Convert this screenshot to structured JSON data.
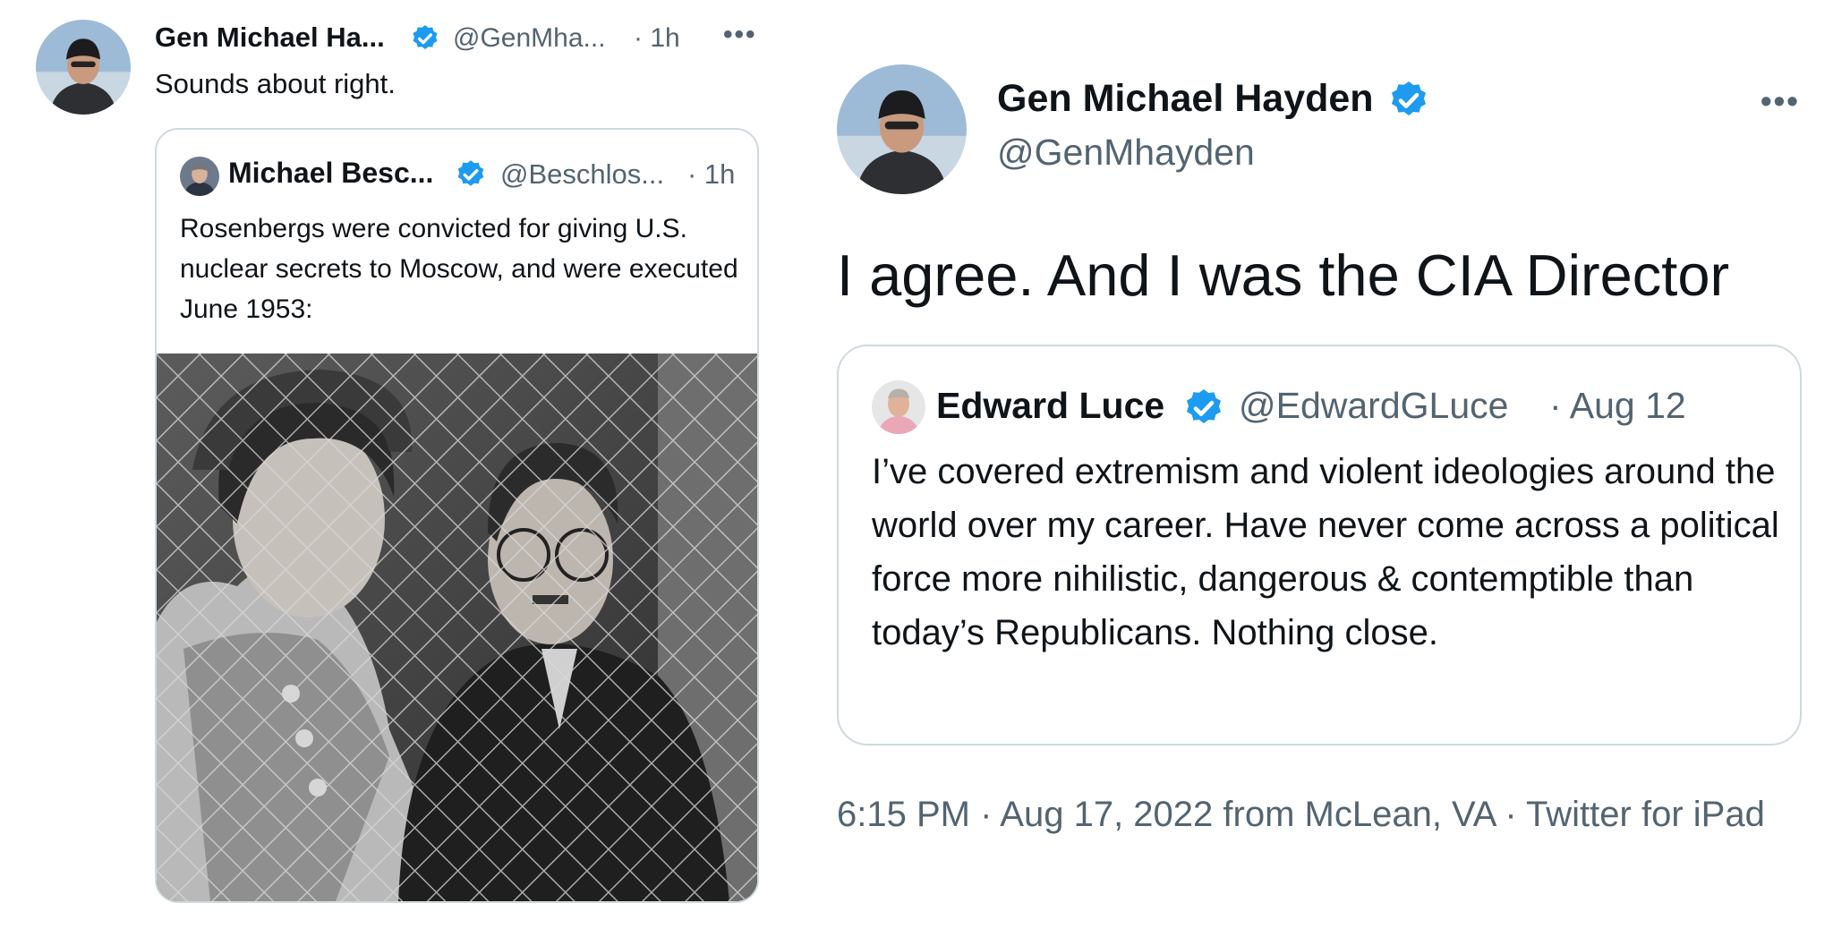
{
  "left_tweet": {
    "author_name": "Gen Michael Ha...",
    "handle": "@GenMha...",
    "time": "· 1h",
    "more": "•••",
    "text": "Sounds about right.",
    "quoted": {
      "author_name": "Michael Besc...",
      "handle": "@Beschlos...",
      "time": "· 1h",
      "text": "Rosenbergs were convicted for giving U.S. nuclear secrets to Moscow, and were executed June 1953:"
    }
  },
  "right_tweet": {
    "author_name": "Gen Michael Hayden",
    "handle": "@GenMhayden",
    "more": "•••",
    "text": "I agree.  And I was the CIA Director",
    "quoted": {
      "author_name": "Edward Luce",
      "handle": "@EdwardGLuce",
      "date": "· Aug 12",
      "text": "I’ve covered extremism and violent ideologies around the world over my career. Have never come across a political force more nihilistic, dangerous & contemptible than today’s Republicans. Nothing close."
    },
    "meta": "6:15 PM · Aug 17, 2022 from McLean, VA · Twitter for iPad"
  },
  "colors": {
    "verified": "#1d9bf0",
    "muted_text": "#536471",
    "border": "#cfd9de"
  },
  "icons": [
    "verified-badge-icon",
    "more-icon"
  ]
}
